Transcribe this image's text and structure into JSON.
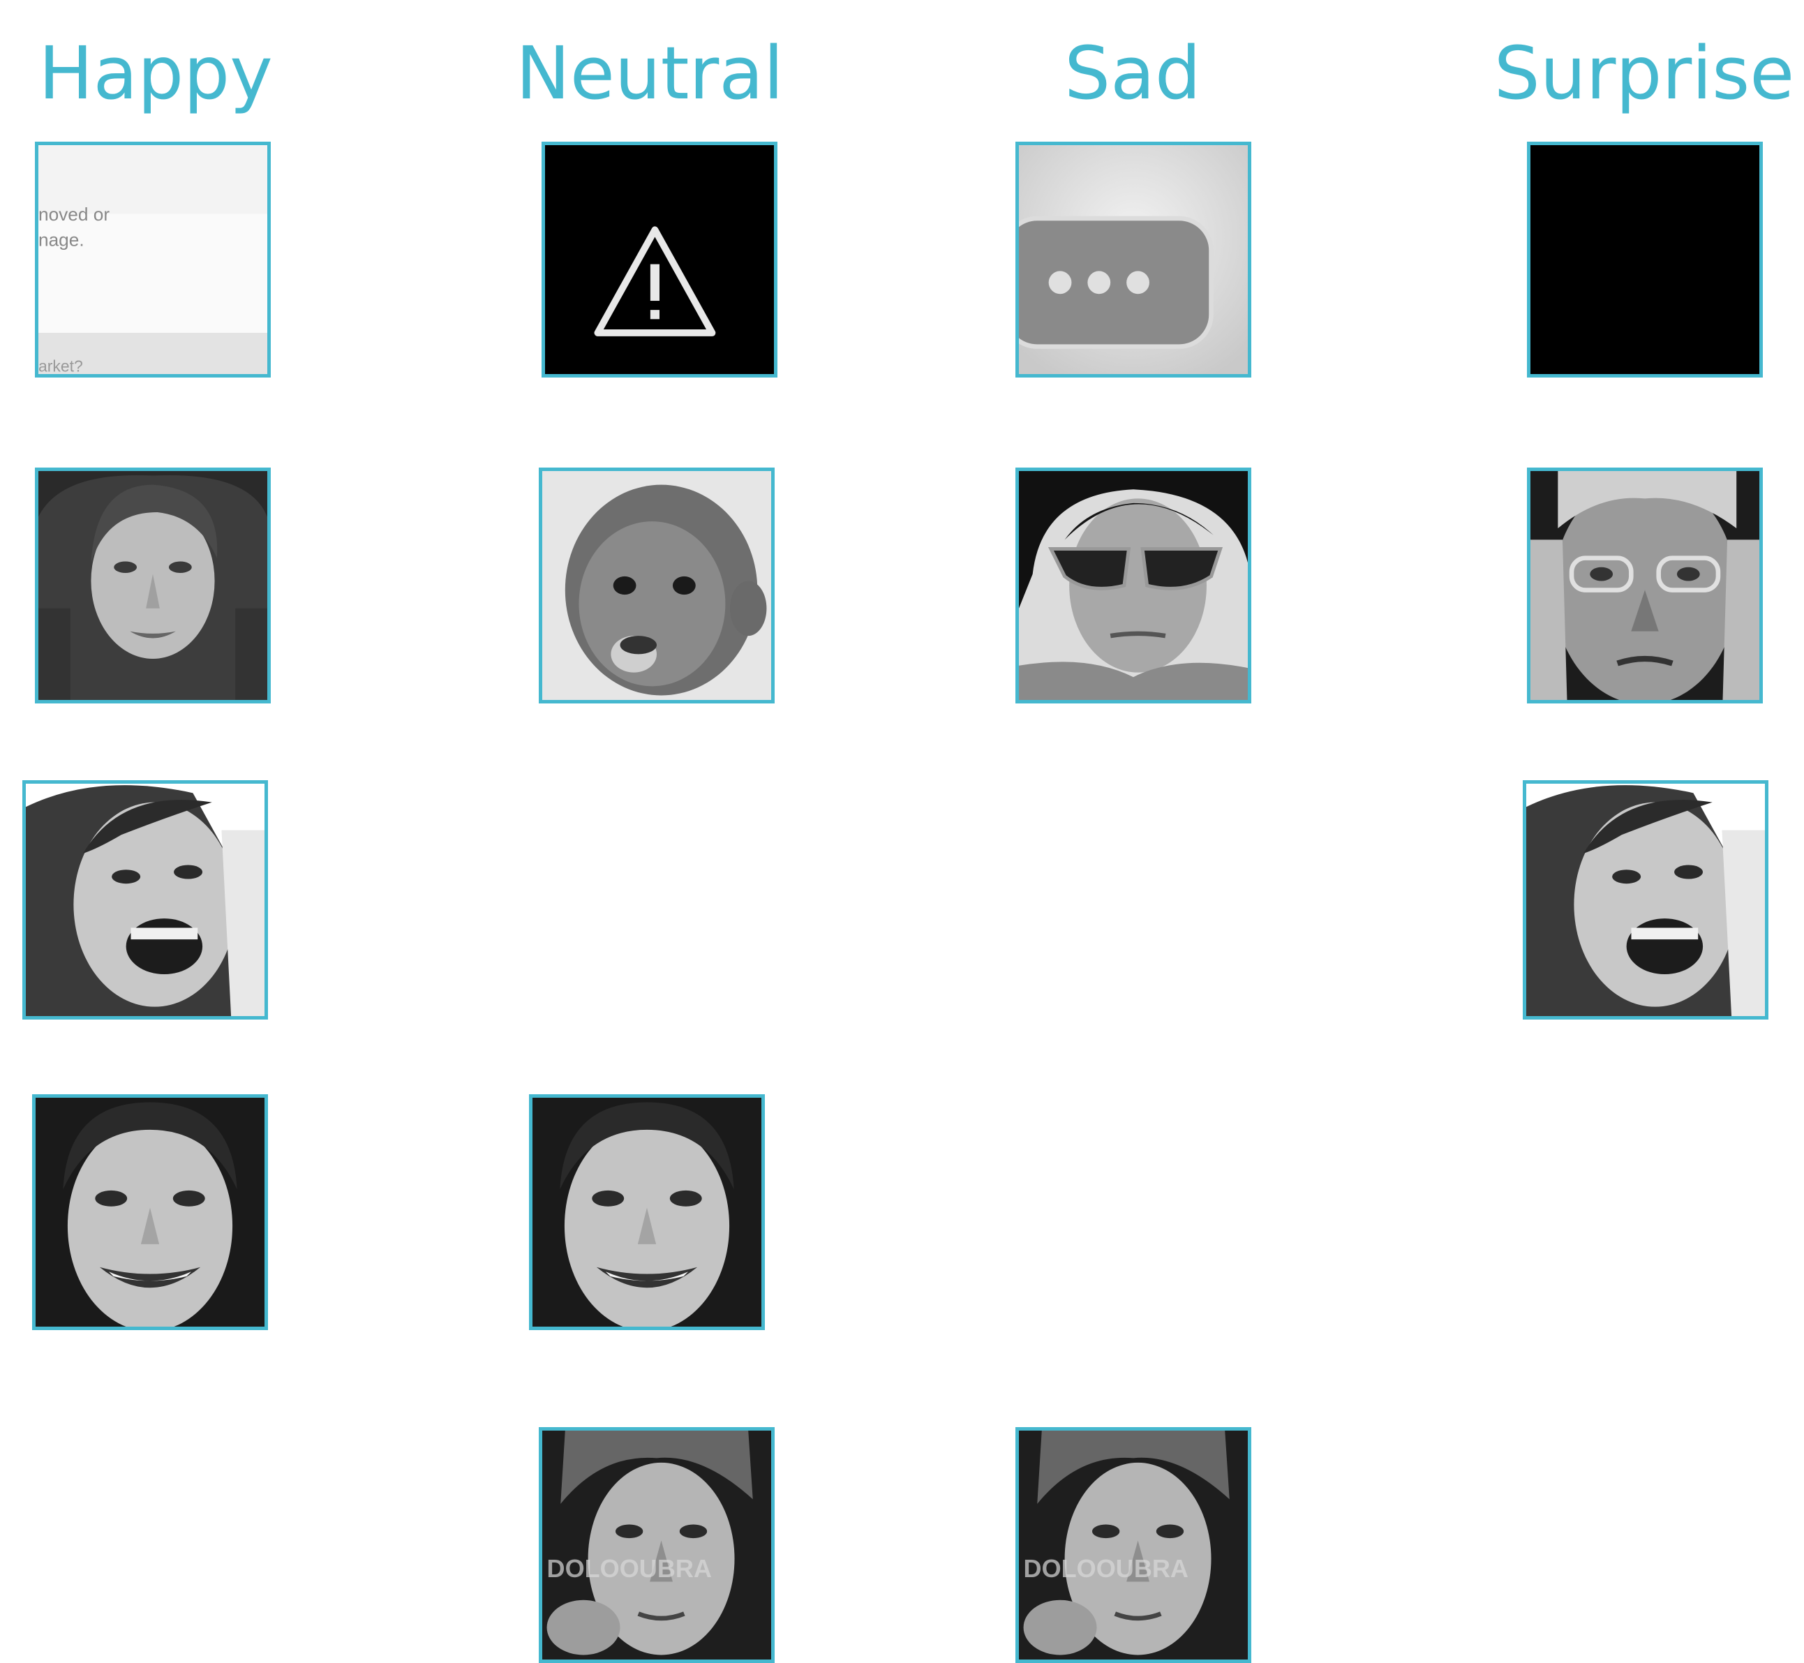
{
  "columns": [
    {
      "label": "Happy"
    },
    {
      "label": "Neutral"
    },
    {
      "label": "Sad"
    },
    {
      "label": "Surprise"
    }
  ],
  "accent_color": "#45b8cf",
  "tiles": {
    "happy_broken_image": {
      "text_line1": "noved or",
      "text_line2": "nage.",
      "text_line3": "arket?"
    },
    "neutral_warning": {
      "icon": "warning-triangle-icon"
    },
    "sad_ellipsis": {
      "icon": "ellipsis-icon"
    },
    "surprise_black": {
      "icon": "blank-image"
    },
    "watermark_text": "DOLOOUBRA"
  }
}
